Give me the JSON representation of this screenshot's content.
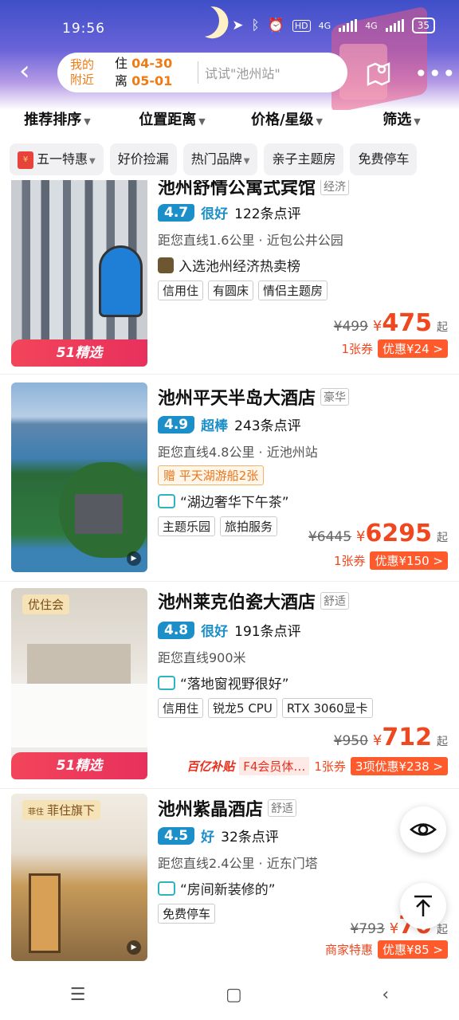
{
  "status": {
    "time": "19:56",
    "battery": "35",
    "net1": "4G",
    "net2": "4G",
    "hd": "HD"
  },
  "search": {
    "loc_line1": "我的",
    "loc_line2": "附近",
    "checkin_label": "住",
    "checkin": "04-30",
    "checkout_label": "离",
    "checkout": "05-01",
    "placeholder": "试试\"池州站\""
  },
  "sorts": [
    "推荐排序",
    "位置距离",
    "价格/星级",
    "筛选"
  ],
  "tags": [
    "五一特惠",
    "好价捡漏",
    "热门品牌",
    "亲子主题房",
    "免费停车"
  ],
  "hotels": [
    {
      "name": "池州舒情公寓式宾馆",
      "level": "经济",
      "score": "4.7",
      "rating": "很好",
      "reviews": "122条点评",
      "distance": "距您直线1.6公里",
      "near": "近包公井公园",
      "feature": "入选池州经济热卖榜",
      "chips": [
        "信用住",
        "有圆床",
        "情侣主题房"
      ],
      "orig": "¥499",
      "yen": "¥",
      "price": "475",
      "qi": "起",
      "coupon": "1张券",
      "discount": "优惠¥24 >",
      "badge": "51精选"
    },
    {
      "name": "池州平天半岛大酒店",
      "level": "豪华",
      "score": "4.9",
      "rating": "超棒",
      "reviews": "243条点评",
      "distance": "距您直线4.8公里",
      "near": "近池州站",
      "gift": "赠  平天湖游船2张",
      "quote": "“湖边奢华下午茶”",
      "chips": [
        "主题乐园",
        "旅拍服务"
      ],
      "orig": "¥6445",
      "yen": "¥",
      "price": "6295",
      "qi": "起",
      "coupon": "1张券",
      "discount": "优惠¥150 >"
    },
    {
      "name": "池州莱克伯瓷大酒店",
      "level": "舒适",
      "score": "4.8",
      "rating": "很好",
      "reviews": "191条点评",
      "distance": "距您直线900米",
      "quote": "“落地窗视野很好”",
      "chips": [
        "信用住",
        "锐龙5 CPU",
        "RTX 3060显卡"
      ],
      "orig": "¥950",
      "yen": "¥",
      "price": "712",
      "qi": "起",
      "subsidy": "百亿补贴",
      "member": "F4会员体…",
      "coupon": "1张券",
      "discount": "3项优惠¥238 >",
      "label": "优住会",
      "badge": "51精选"
    },
    {
      "name": "池州紫晶酒店",
      "level": "舒适",
      "score": "4.5",
      "rating": "好",
      "reviews": "32条点评",
      "distance": "距您直线2.4公里",
      "near": "近东门塔",
      "quote": "“房间新装修的”",
      "chips": [
        "免费停车"
      ],
      "orig": "¥793",
      "yen": "¥",
      "price": "70",
      "qi": "起",
      "special": "商家特惠",
      "discount": "优惠¥85 >",
      "label_small": "菲住",
      "label": "菲住旗下"
    }
  ],
  "colors": {
    "accent": "#f0471f",
    "rating": "#1d8fc8",
    "orange": "#f07b14"
  }
}
